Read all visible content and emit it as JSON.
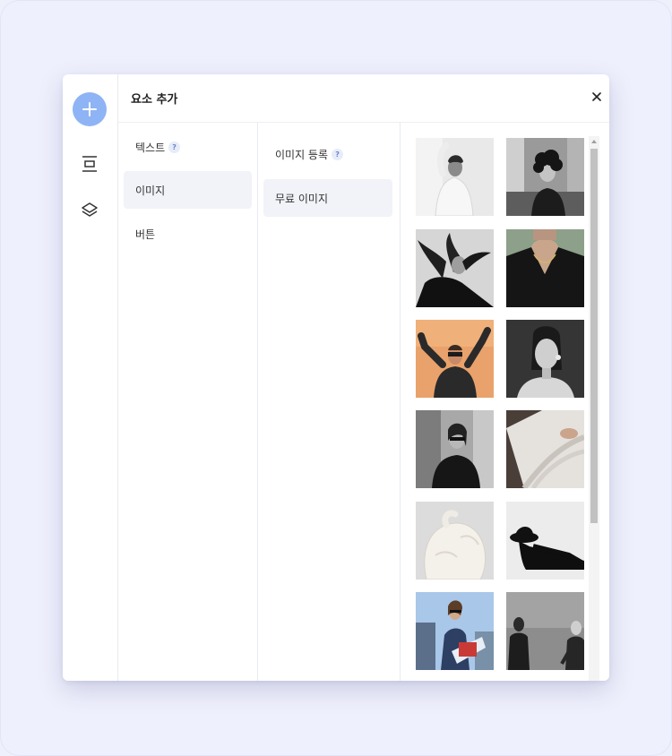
{
  "panel": {
    "title": "요소 추가",
    "close_label": "×"
  },
  "rail": {
    "items": [
      "plus-icon",
      "align-icon",
      "layers-icon"
    ]
  },
  "categories": [
    {
      "label": "텍스트",
      "help": "?"
    },
    {
      "label": "이미지",
      "active": true
    },
    {
      "label": "버튼"
    }
  ],
  "subcategories": [
    {
      "label": "이미지 등록",
      "help": "?"
    },
    {
      "label": "무료 이미지",
      "active": true
    }
  ],
  "gallery": {
    "images": [
      "woman-white-sweater-photo",
      "woman-curly-hair-street-photo",
      "woman-flowing-hair-photo",
      "woman-necklace-blazer-photo",
      "woman-orange-background-photo",
      "woman-portrait-dark-photo",
      "woman-sunglasses-street-photo",
      "woman-knit-fabric-photo",
      "fluffy-white-coat-photo",
      "woman-black-hat-photo",
      "woman-sunglasses-sky-photo",
      "mannequins-gray-photo"
    ]
  },
  "colors": {
    "accent": "#8fb4f5",
    "active_bg": "#f1f3f8",
    "background": "#eff0fd"
  }
}
